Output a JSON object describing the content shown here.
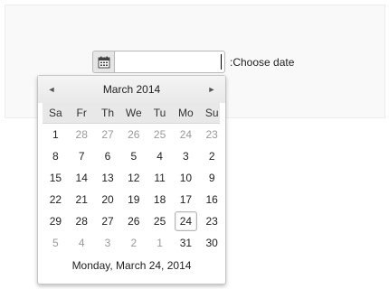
{
  "field": {
    "label": ":Choose date",
    "value": ""
  },
  "calendar": {
    "title": "March 2014",
    "prev_glyph": "◄",
    "next_glyph": "►",
    "weekdays": [
      "Sa",
      "Fr",
      "Th",
      "We",
      "Tu",
      "Mo",
      "Su"
    ],
    "weeks": [
      [
        {
          "d": "1",
          "o": false
        },
        {
          "d": "28",
          "o": true
        },
        {
          "d": "27",
          "o": true
        },
        {
          "d": "26",
          "o": true
        },
        {
          "d": "25",
          "o": true
        },
        {
          "d": "24",
          "o": true
        },
        {
          "d": "23",
          "o": true
        }
      ],
      [
        {
          "d": "8",
          "o": false
        },
        {
          "d": "7",
          "o": false
        },
        {
          "d": "6",
          "o": false
        },
        {
          "d": "5",
          "o": false
        },
        {
          "d": "4",
          "o": false
        },
        {
          "d": "3",
          "o": false
        },
        {
          "d": "2",
          "o": false
        }
      ],
      [
        {
          "d": "15",
          "o": false
        },
        {
          "d": "14",
          "o": false
        },
        {
          "d": "13",
          "o": false
        },
        {
          "d": "12",
          "o": false
        },
        {
          "d": "11",
          "o": false
        },
        {
          "d": "10",
          "o": false
        },
        {
          "d": "9",
          "o": false
        }
      ],
      [
        {
          "d": "22",
          "o": false
        },
        {
          "d": "21",
          "o": false
        },
        {
          "d": "20",
          "o": false
        },
        {
          "d": "19",
          "o": false
        },
        {
          "d": "18",
          "o": false
        },
        {
          "d": "17",
          "o": false
        },
        {
          "d": "16",
          "o": false
        }
      ],
      [
        {
          "d": "29",
          "o": false
        },
        {
          "d": "28",
          "o": false
        },
        {
          "d": "27",
          "o": false
        },
        {
          "d": "26",
          "o": false
        },
        {
          "d": "25",
          "o": false
        },
        {
          "d": "24",
          "o": false,
          "today": true
        },
        {
          "d": "23",
          "o": false
        }
      ],
      [
        {
          "d": "5",
          "o": true
        },
        {
          "d": "4",
          "o": true
        },
        {
          "d": "3",
          "o": true
        },
        {
          "d": "2",
          "o": true
        },
        {
          "d": "1",
          "o": true
        },
        {
          "d": "31",
          "o": false
        },
        {
          "d": "30",
          "o": false
        }
      ]
    ],
    "footer": "Monday, March 24, 2014"
  },
  "icons": {
    "calendar_button": "calendar-icon"
  }
}
